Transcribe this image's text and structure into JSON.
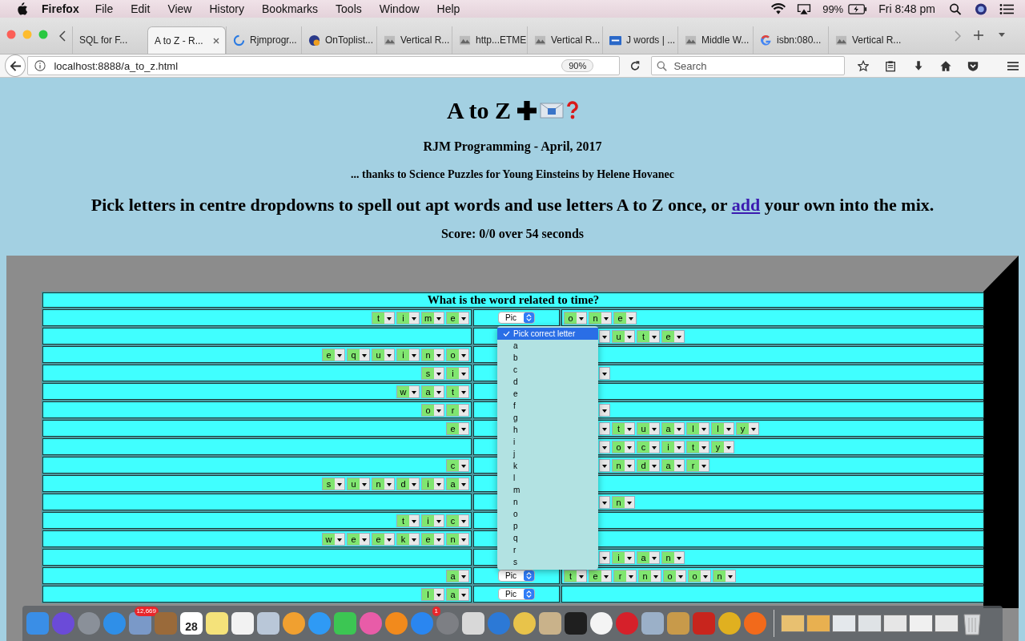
{
  "menu_bar": {
    "app": "Firefox",
    "items": [
      "File",
      "Edit",
      "View",
      "History",
      "Bookmarks",
      "Tools",
      "Window",
      "Help"
    ],
    "battery": "99%",
    "clock": "Fri 8:48 pm"
  },
  "tabs": [
    {
      "label": "SQL for F...",
      "selected": false
    },
    {
      "label": "A to Z - R...",
      "selected": true
    },
    {
      "label": "Rjmprogr...",
      "selected": false
    },
    {
      "label": "OnToplist...",
      "selected": false
    },
    {
      "label": "Vertical R...",
      "selected": false
    },
    {
      "label": "http...ETME",
      "selected": false
    },
    {
      "label": "Vertical R...",
      "selected": false
    },
    {
      "label": "J words | ...",
      "selected": false
    },
    {
      "label": "Middle W...",
      "selected": false
    },
    {
      "label": "isbn:080...",
      "selected": false
    },
    {
      "label": "Vertical R...",
      "selected": false
    }
  ],
  "address_bar": {
    "url": "localhost:8888/a_to_z.html",
    "zoom": "90%"
  },
  "search": {
    "placeholder": "Search"
  },
  "page": {
    "title": "A to Z",
    "byline": "RJM Programming - April, 2017",
    "credit": "... thanks to Science Puzzles for Young Einsteins by Helene Hovanec",
    "instructions_before": "Pick letters in centre dropdowns to spell out apt words and use letters A to Z once, or ",
    "link": "add",
    "instructions_after": " your own into the mix.",
    "score": "Score: 0/0 over 54 seconds"
  },
  "puzzle": {
    "question": "What is the word related to time?",
    "rows": [
      {
        "left": [
          "t",
          "i",
          "m",
          "e"
        ],
        "pick": "Pic",
        "stub": false,
        "right": [
          "o",
          "n",
          "e"
        ]
      },
      {
        "left": [],
        "stub": true,
        "right": [
          "u",
          "t",
          "e"
        ]
      },
      {
        "left": [
          "e",
          "q",
          "u",
          "i",
          "n",
          "o"
        ],
        "stub": false,
        "right": []
      },
      {
        "left": [
          "s",
          "i"
        ],
        "stub": true,
        "right": []
      },
      {
        "left": [
          "w",
          "a",
          "t"
        ],
        "stub": false,
        "right": []
      },
      {
        "left": [
          "o",
          "r"
        ],
        "stub": true,
        "right": []
      },
      {
        "left": [
          "e"
        ],
        "stub": true,
        "right": [
          "t",
          "u",
          "a",
          "l",
          "l",
          "y"
        ]
      },
      {
        "left": [],
        "stub": true,
        "right": [
          "o",
          "c",
          "i",
          "t",
          "y"
        ]
      },
      {
        "left": [
          "c"
        ],
        "stub": true,
        "right": [
          "n",
          "d",
          "a",
          "r"
        ]
      },
      {
        "left": [
          "s",
          "u",
          "n",
          "d",
          "i",
          "a"
        ],
        "stub": false,
        "right": []
      },
      {
        "left": [],
        "stub": true,
        "right": [
          "n"
        ]
      },
      {
        "left": [
          "t",
          "i",
          "c"
        ],
        "stub": false,
        "right": []
      },
      {
        "left": [
          "w",
          "e",
          "e",
          "k",
          "e",
          "n"
        ],
        "stub": false,
        "right": []
      },
      {
        "left": [],
        "stub": true,
        "right": [
          "i",
          "a",
          "n"
        ]
      },
      {
        "left": [
          "a"
        ],
        "pick": "Pic",
        "stub": false,
        "right": [
          "t",
          "e",
          "r",
          "n",
          "o",
          "o",
          "n"
        ]
      },
      {
        "left": [
          "l",
          "a"
        ],
        "pick": "Pic",
        "stub": false,
        "right": []
      }
    ]
  },
  "dropdown": {
    "options": [
      {
        "label": "Pick correct letter",
        "selected": true
      },
      {
        "label": "a",
        "selected": false
      },
      {
        "label": "b",
        "selected": false
      },
      {
        "label": "c",
        "selected": false
      },
      {
        "label": "d",
        "selected": false
      },
      {
        "label": "e",
        "selected": false
      },
      {
        "label": "f",
        "selected": false
      },
      {
        "label": "g",
        "selected": false
      },
      {
        "label": "h",
        "selected": false
      },
      {
        "label": "i",
        "selected": false
      },
      {
        "label": "j",
        "selected": false
      },
      {
        "label": "k",
        "selected": false
      },
      {
        "label": "l",
        "selected": false
      },
      {
        "label": "m",
        "selected": false
      },
      {
        "label": "n",
        "selected": false
      },
      {
        "label": "o",
        "selected": false
      },
      {
        "label": "p",
        "selected": false
      },
      {
        "label": "q",
        "selected": false
      },
      {
        "label": "r",
        "selected": false
      },
      {
        "label": "s",
        "selected": false
      }
    ]
  },
  "dock": {
    "items": [
      {
        "kind": "app",
        "color": "#3a8ee6"
      },
      {
        "kind": "round",
        "color": "#6b4bd8"
      },
      {
        "kind": "round",
        "color": "#8a9099"
      },
      {
        "kind": "round",
        "color": "#2f8fe8"
      },
      {
        "kind": "app",
        "color": "#7a99c8",
        "badge": "12,669"
      },
      {
        "kind": "app",
        "color": "#9a6a3a"
      },
      {
        "kind": "calendar",
        "color": "#ffffff",
        "text": "28"
      },
      {
        "kind": "app",
        "color": "#f4e27a"
      },
      {
        "kind": "app",
        "color": "#f2f2f2"
      },
      {
        "kind": "app",
        "color": "#b9c7d8"
      },
      {
        "kind": "round",
        "color": "#f0a030"
      },
      {
        "kind": "round",
        "color": "#2f9af5"
      },
      {
        "kind": "app",
        "color": "#3cc653"
      },
      {
        "kind": "round",
        "color": "#e85ca8"
      },
      {
        "kind": "round",
        "color": "#f28a1c"
      },
      {
        "kind": "round",
        "color": "#2a86f0",
        "badge": "1"
      },
      {
        "kind": "round",
        "color": "#7d7f84"
      },
      {
        "kind": "app",
        "color": "#d8d8d8"
      },
      {
        "kind": "round",
        "color": "#2c79d6"
      },
      {
        "kind": "round",
        "color": "#e8c34a"
      },
      {
        "kind": "app",
        "color": "#c9b28a"
      },
      {
        "kind": "app",
        "color": "#1f1f1f"
      },
      {
        "kind": "round",
        "color": "#f4f4f4"
      },
      {
        "kind": "round",
        "color": "#d6202a"
      },
      {
        "kind": "app",
        "color": "#9bb0c8"
      },
      {
        "kind": "app",
        "color": "#c89a4a"
      },
      {
        "kind": "app",
        "color": "#c8251d"
      },
      {
        "kind": "round",
        "color": "#e0b020"
      },
      {
        "kind": "round",
        "color": "#f26a1b"
      },
      {
        "kind": "separator"
      },
      {
        "kind": "window",
        "color": "#e8c070"
      },
      {
        "kind": "window",
        "color": "#e8b050"
      },
      {
        "kind": "window",
        "color": "#e4e8ec"
      },
      {
        "kind": "window",
        "color": "#dfe3e6"
      },
      {
        "kind": "window",
        "color": "#e6e6e6"
      },
      {
        "kind": "window",
        "color": "#f0f0f0"
      },
      {
        "kind": "window",
        "color": "#e8e8e8"
      },
      {
        "kind": "trash",
        "color": "#d8dadc"
      }
    ]
  }
}
